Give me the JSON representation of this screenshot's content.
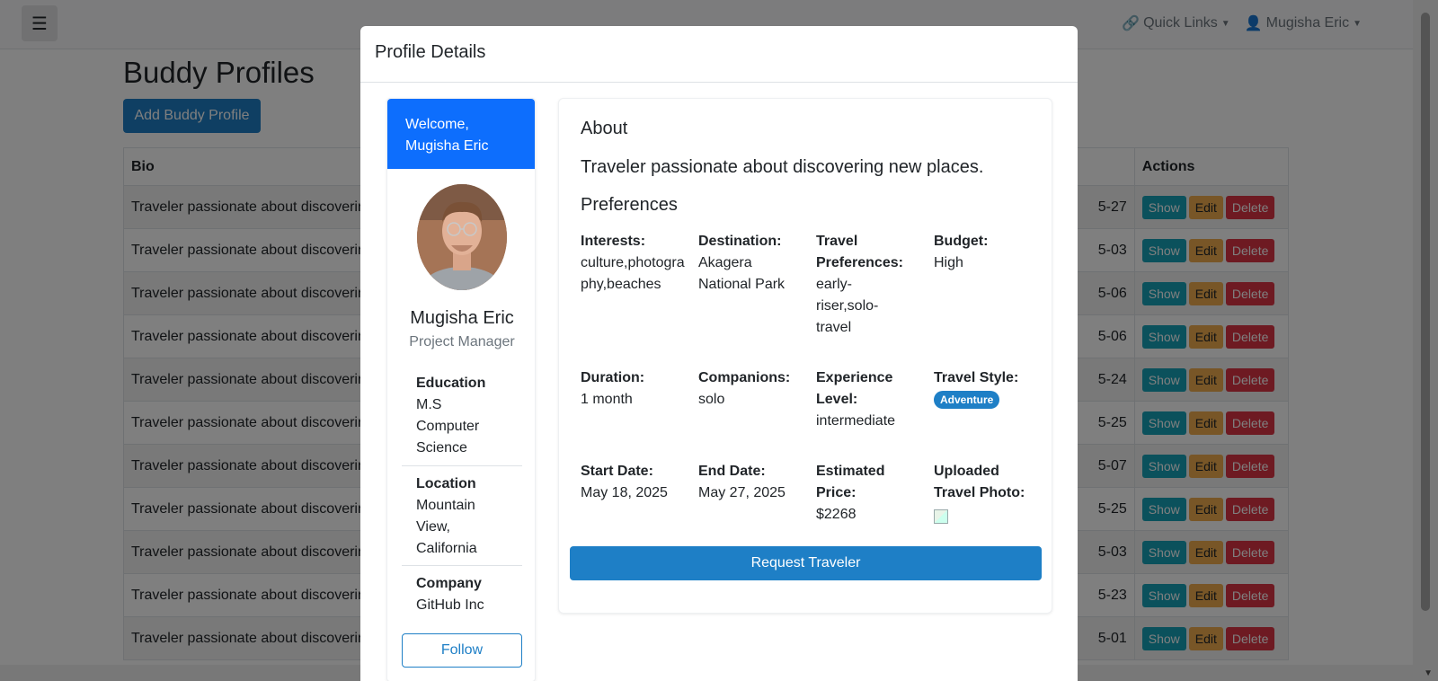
{
  "navbar": {
    "menu_icon": "hamburger-icon",
    "quick_links": "Quick Links",
    "user_name": "Mugisha Eric"
  },
  "page": {
    "title": "Buddy Profiles",
    "add_button": "Add Buddy Profile"
  },
  "table": {
    "headers": {
      "bio": "Bio",
      "actions": "Actions"
    },
    "action_labels": {
      "show": "Show",
      "edit": "Edit",
      "delete": "Delete"
    },
    "rows": [
      {
        "bio": "Traveler passionate about discovering new places.",
        "date": "5-27"
      },
      {
        "bio": "Traveler passionate about discovering new places.",
        "date": "5-03"
      },
      {
        "bio": "Traveler passionate about discovering new places.",
        "date": "5-06"
      },
      {
        "bio": "Traveler passionate about discovering new places.",
        "date": "5-06"
      },
      {
        "bio": "Traveler passionate about discovering new places.",
        "date": "5-24"
      },
      {
        "bio": "Traveler passionate about discovering new places.",
        "date": "5-25"
      },
      {
        "bio": "Traveler passionate about discovering new places.",
        "date": "5-07"
      },
      {
        "bio": "Traveler passionate about discovering new places.",
        "date": "5-25"
      },
      {
        "bio": "Traveler passionate about discovering new places.",
        "date": "5-03"
      },
      {
        "bio": "Traveler passionate about discovering new places.",
        "date": "5-23"
      },
      {
        "bio": "Traveler passionate about discovering new places.",
        "date": "5-01"
      }
    ]
  },
  "modal": {
    "title": "Profile Details",
    "profile": {
      "welcome_line1": "Welcome,",
      "welcome_line2": "Mugisha Eric",
      "name": "Mugisha Eric",
      "role": "Project Manager",
      "education_label": "Education",
      "education_value": "M.S Computer Science",
      "location_label": "Location",
      "location_value": "Mountain View, California",
      "company_label": "Company",
      "company_value": "GitHub Inc",
      "follow_button": "Follow"
    },
    "about": {
      "title": "About",
      "bio": "Traveler passionate about discovering new places.",
      "preferences_title": "Preferences",
      "interests_label": "Interests:",
      "interests_value": "culture,photography,beaches",
      "destination_label": "Destination:",
      "destination_value": "Akagera National Park",
      "travel_pref_label": "Travel Preferences:",
      "travel_pref_value": "early-riser,solo-travel",
      "budget_label": "Budget:",
      "budget_value": "High",
      "duration_label": "Duration:",
      "duration_value": "1 month",
      "companions_label": "Companions:",
      "companions_value": "solo",
      "experience_label": "Experience Level:",
      "experience_value": "intermediate",
      "style_label": "Travel Style:",
      "style_value": "Adventure",
      "start_label": "Start Date:",
      "start_value": "May 18, 2025",
      "end_label": "End Date:",
      "end_value": "May 27, 2025",
      "price_label": "Estimated Price:",
      "price_value": "$2268",
      "photo_label": "Uploaded Travel Photo:",
      "request_button": "Request Traveler"
    }
  },
  "colors": {
    "primary": "#1e7fc6",
    "welcome_bg": "#0d6efd",
    "show": "#17a2b8",
    "edit": "#f0ad4e",
    "delete": "#dc3545"
  }
}
